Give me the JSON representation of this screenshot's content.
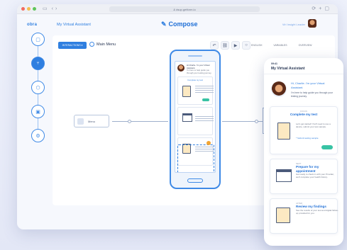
{
  "browser": {
    "url": "& dsup.getform.io",
    "colors": {
      "close": "#f26a5f",
      "minimize": "#f5bd4f",
      "maximize": "#5ec55a"
    }
  },
  "app": {
    "logo": "obra",
    "title": "My Virtual Assistant",
    "page_title": "Compose",
    "user_label": "Virl Insight Leader",
    "accent": "#2f7fe0"
  },
  "rail": {
    "icons": [
      "chat-icon",
      "flow-icon",
      "box-icon",
      "lock-icon",
      "settings-icon"
    ]
  },
  "canvas": {
    "interactions_label": "INTERACTIONS ▾",
    "main_menu_label": "Main Menu",
    "tabs": [
      "ENGLISH",
      "VARIABLES",
      "OVERVIEW"
    ],
    "flow_node_label": "Menu"
  },
  "preview_small": {
    "greeting": "Hi Charlie. I'm your Virtual Assistant.",
    "subtext": "I'm here to help guide you through your testing journey.",
    "card1_title": "Complete my test"
  },
  "preview_large": {
    "status": "09:41",
    "header": "My Virtual Assistant",
    "greeting": "Hi, Charlie. I'm your Virtual Assistant.",
    "subtext": "I'm here to help guide you through your testing journey.",
    "cards": [
      {
        "label": "FOCUS",
        "title": "Complete my test",
        "text": "Let's get started! You'll need to use a device, submit your test sample.",
        "link": "* Submit testing sample"
      },
      {
        "label": "NEXT",
        "title": "Prepare for my appointment",
        "text": "Get ready to check in with your Provider, we'll complete your health history."
      },
      {
        "label": "AFTER",
        "title": "Review my findings",
        "text": "See the results of your test and digital follow-up provided for you."
      }
    ]
  }
}
